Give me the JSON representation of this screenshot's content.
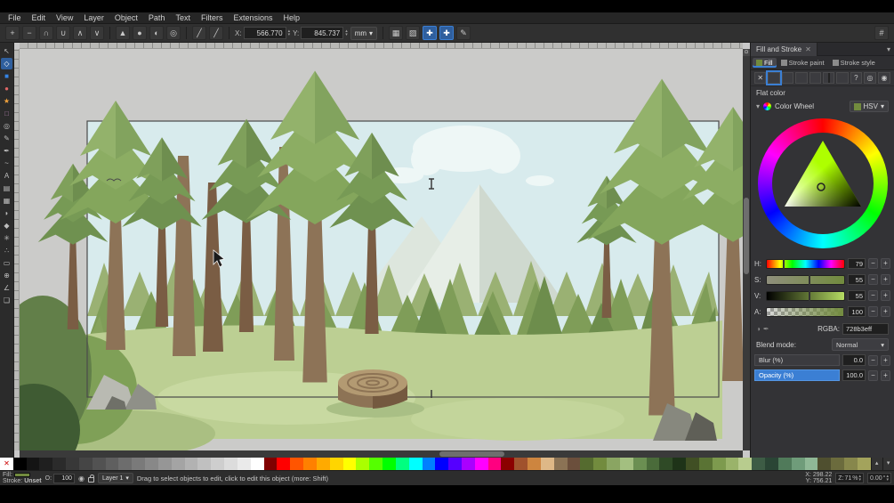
{
  "menubar": {
    "items": [
      "File",
      "Edit",
      "View",
      "Layer",
      "Object",
      "Path",
      "Text",
      "Filters",
      "Extensions",
      "Help"
    ]
  },
  "toolbar": {
    "left_icons": [
      {
        "name": "insert-node-icon",
        "glyph": "+"
      },
      {
        "name": "delete-node-icon",
        "glyph": "−"
      },
      {
        "name": "join-nodes-icon",
        "glyph": "∩"
      },
      {
        "name": "break-nodes-icon",
        "glyph": "∪"
      },
      {
        "name": "join-segment-icon",
        "glyph": "∧"
      },
      {
        "name": "delete-segment-icon",
        "glyph": "∨"
      }
    ],
    "node_type_icons": [
      {
        "name": "node-corner-icon",
        "glyph": "▲"
      },
      {
        "name": "node-smooth-icon",
        "glyph": "●"
      },
      {
        "name": "node-symmetric-icon",
        "glyph": "◐"
      },
      {
        "name": "node-auto-icon",
        "glyph": "◎"
      }
    ],
    "path_icons": [
      {
        "name": "object-to-path-icon",
        "glyph": "╱"
      },
      {
        "name": "stroke-to-path-icon",
        "glyph": "╱"
      }
    ],
    "x_label": "X:",
    "x_value": "566.770",
    "y_label": "Y:",
    "y_value": "845.737",
    "unit": "mm",
    "toggle_icons": [
      {
        "name": "edit-clip-icon",
        "glyph": "▦",
        "active": false
      },
      {
        "name": "edit-mask-icon",
        "glyph": "▨",
        "active": false
      },
      {
        "name": "show-transform-handles-icon",
        "glyph": "✚",
        "active": true
      },
      {
        "name": "show-bezier-handles-icon",
        "glyph": "✚",
        "active": true
      },
      {
        "name": "show-outline-icon",
        "glyph": "✎",
        "active": false
      }
    ],
    "snap_icon": {
      "name": "snap-toggle-icon",
      "glyph": "#"
    }
  },
  "toolbox": {
    "tools": [
      {
        "name": "selector-tool",
        "glyph": "↖",
        "selected": false
      },
      {
        "name": "node-tool",
        "glyph": "◇",
        "selected": true
      },
      {
        "name": "rectangle-tool",
        "glyph": "■",
        "color": "#3584e4"
      },
      {
        "name": "ellipse-tool",
        "glyph": "●",
        "color": "#e06666"
      },
      {
        "name": "star-tool",
        "glyph": "★",
        "color": "#f2a33c"
      },
      {
        "name": "box3d-tool",
        "glyph": "□",
        "color": "#ad7fa8"
      },
      {
        "name": "spiral-tool",
        "glyph": "◎"
      },
      {
        "name": "pencil-tool",
        "glyph": "✎"
      },
      {
        "name": "pen-tool",
        "glyph": "✒"
      },
      {
        "name": "calligraphy-tool",
        "glyph": "~"
      },
      {
        "name": "text-tool",
        "glyph": "A"
      },
      {
        "name": "gradient-tool",
        "glyph": "▤"
      },
      {
        "name": "mesh-tool",
        "glyph": "▦"
      },
      {
        "name": "dropper-tool",
        "glyph": "◗"
      },
      {
        "name": "paint-bucket-tool",
        "glyph": "◆"
      },
      {
        "name": "tweak-tool",
        "glyph": "✳"
      },
      {
        "name": "spray-tool",
        "glyph": "∴"
      },
      {
        "name": "eraser-tool",
        "glyph": "▭"
      },
      {
        "name": "zoom-tool",
        "glyph": "⊕"
      },
      {
        "name": "measure-tool",
        "glyph": "∠"
      },
      {
        "name": "pages-tool",
        "glyph": "❏"
      }
    ]
  },
  "panel": {
    "title": "Fill and Stroke",
    "close_glyph": "✕",
    "tabs": [
      {
        "label": "Fill",
        "active": true
      },
      {
        "label": "Stroke paint",
        "active": false
      },
      {
        "label": "Stroke style",
        "active": false
      }
    ],
    "paint_modes": [
      {
        "name": "paint-none",
        "kind": "x"
      },
      {
        "name": "paint-flat",
        "kind": "flat",
        "selected": true
      },
      {
        "name": "paint-linear-gradient",
        "kind": "linear"
      },
      {
        "name": "paint-radial-gradient",
        "kind": "radial"
      },
      {
        "name": "paint-pattern",
        "kind": "pattern"
      },
      {
        "name": "paint-swatch",
        "kind": "swatch"
      },
      {
        "name": "paint-mesh",
        "kind": "mesh"
      },
      {
        "name": "paint-unknown",
        "kind": "unknown"
      }
    ],
    "flat_color_label": "Flat color",
    "selector_label": "Color Wheel",
    "mode_dropdown": "HSV",
    "sliders": [
      {
        "label": "H:",
        "value": "79",
        "max": 360,
        "kind": "h"
      },
      {
        "label": "S:",
        "value": "55",
        "max": 100,
        "kind": "s"
      },
      {
        "label": "V:",
        "value": "55",
        "max": 100,
        "kind": "v"
      },
      {
        "label": "A:",
        "value": "100",
        "max": 100,
        "kind": "a"
      }
    ],
    "rgba_label": "RGBA:",
    "rgba_value": "728b3eff",
    "blend_label": "Blend mode:",
    "blend_value": "Normal",
    "blur_label": "Blur (%)",
    "blur_value": "0.0",
    "opacity_label": "Opacity (%)",
    "opacity_value": "100.0",
    "accent_color": "#3b7fd4",
    "current_color": "#728b3e"
  },
  "palette": {
    "colors": [
      "none",
      "#000000",
      "#141414",
      "#1f1f1f",
      "#2b2b2b",
      "#383838",
      "#454545",
      "#525252",
      "#5f5f5f",
      "#6d6d6d",
      "#7a7a7a",
      "#888888",
      "#969696",
      "#a4a4a4",
      "#b2b2b2",
      "#c0c0c0",
      "#cecece",
      "#dcdcdc",
      "#eaeaea",
      "#ffffff",
      "#800000",
      "#ff0000",
      "#ff5500",
      "#ff8000",
      "#ffaa00",
      "#ffd500",
      "#ffff00",
      "#aaff00",
      "#55ff00",
      "#00ff00",
      "#00ff80",
      "#00ffff",
      "#0080ff",
      "#0000ff",
      "#5500ff",
      "#aa00ff",
      "#ff00ff",
      "#ff0080",
      "#8b0000",
      "#a0522d",
      "#cd853f",
      "#deb887",
      "#8b7355",
      "#6b4f3c",
      "#556b2f",
      "#728b3e",
      "#8aa562",
      "#a3bf80",
      "#6b8f52",
      "#4a6b3a",
      "#2f4a26",
      "#1e3318",
      "#404f24",
      "#5a7334",
      "#7d9a4e",
      "#9ab36a",
      "#b8cc8e",
      "#3d5c45",
      "#2a4535",
      "#507a5a",
      "#6f9c7a",
      "#8fb896",
      "#4f4f2f",
      "#6b6b3d",
      "#87874c",
      "#a3a35c"
    ]
  },
  "statusbar": {
    "fill_label": "Fill:",
    "fill_color": "#728b3e",
    "stroke_label": "Stroke:",
    "stroke_value": "Unset",
    "opacity_label": "O:",
    "opacity_value": "100",
    "layer_label": "Layer 1",
    "message": "Drag to select objects to edit, click to edit this object (more: Shift)",
    "cursor_x_label": "X:",
    "cursor_x": "298.22",
    "cursor_y_label": "Y:",
    "cursor_y": "756.21",
    "zoom_label": "Z:",
    "zoom_value": "71",
    "zoom_unit": "%",
    "rotation_value": "0.00",
    "rotation_unit": "°"
  }
}
